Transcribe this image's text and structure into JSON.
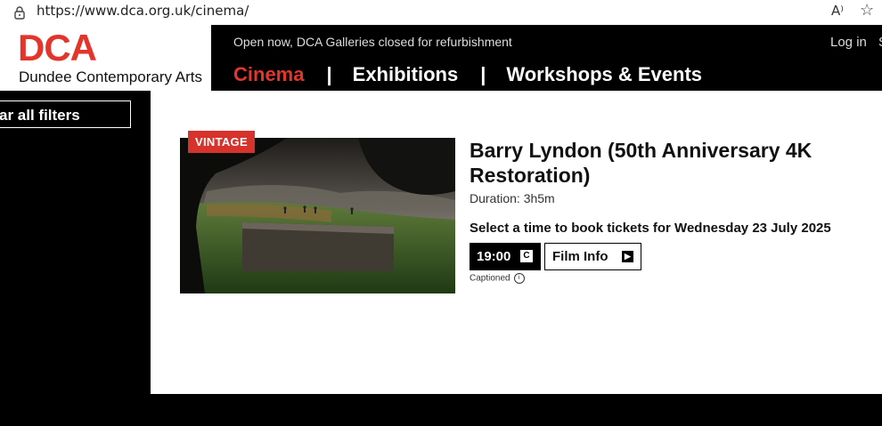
{
  "browser": {
    "url": "https://www.dca.org.uk/cinema/",
    "read_aloud": "A⁾",
    "favorite_icon": "star-icon"
  },
  "header": {
    "logo": "DCA",
    "logo_sub": "Dundee Contemporary Arts",
    "notice": "Open now, DCA Galleries closed for refurbishment",
    "login": "Log in",
    "extra": "S",
    "nav": [
      {
        "label": "Cinema",
        "active": true
      },
      {
        "label": "Exhibitions",
        "active": false
      },
      {
        "label": "Workshops & Events",
        "active": false
      }
    ],
    "separator": "|",
    "brand_color": "#e3352b"
  },
  "filters": {
    "clear_label": "ar all filters"
  },
  "film": {
    "badge": "VINTAGE",
    "title": "Barry Lyndon (50th Anniversary 4K Restoration)",
    "duration": "Duration: 3h5m",
    "select_time": "Select a time to book tickets for Wednesday 23 July 2025",
    "showtime": "19:00",
    "caption_badge": "C",
    "film_info": "Film Info",
    "arrow_glyph": "▶",
    "captioned": "Captioned",
    "info_glyph": "i"
  }
}
